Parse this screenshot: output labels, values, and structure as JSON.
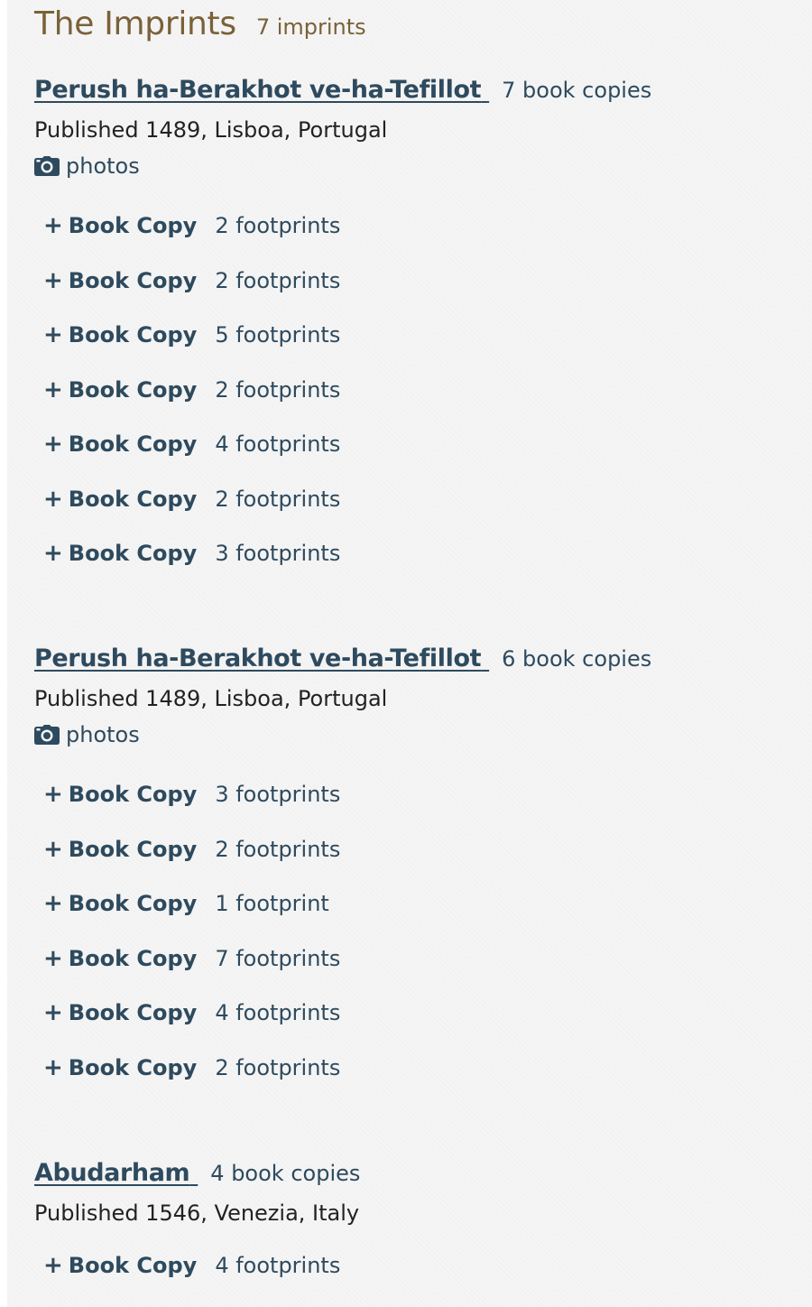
{
  "section": {
    "title": "The Imprints",
    "count": "7 imprints"
  },
  "imprints": [
    {
      "title": "Perush ha-Berakhot ve-ha-Tefillot",
      "copies_count": "7 book copies",
      "published": "Published 1489, Lisboa, Portugal",
      "photos_label": "photos",
      "copies": [
        {
          "label": "Book Copy",
          "footprints": "2 footprints"
        },
        {
          "label": "Book Copy",
          "footprints": "2 footprints"
        },
        {
          "label": "Book Copy",
          "footprints": "5 footprints"
        },
        {
          "label": "Book Copy",
          "footprints": "2 footprints"
        },
        {
          "label": "Book Copy",
          "footprints": "4 footprints"
        },
        {
          "label": "Book Copy",
          "footprints": "2 footprints"
        },
        {
          "label": "Book Copy",
          "footprints": "3 footprints"
        }
      ]
    },
    {
      "title": "Perush ha-Berakhot ve-ha-Tefillot",
      "copies_count": "6 book copies",
      "published": "Published 1489, Lisboa, Portugal",
      "photos_label": "photos",
      "copies": [
        {
          "label": "Book Copy",
          "footprints": "3 footprints"
        },
        {
          "label": "Book Copy",
          "footprints": "2 footprints"
        },
        {
          "label": "Book Copy",
          "footprints": "1 footprint"
        },
        {
          "label": "Book Copy",
          "footprints": "7 footprints"
        },
        {
          "label": "Book Copy",
          "footprints": "4 footprints"
        },
        {
          "label": "Book Copy",
          "footprints": "2 footprints"
        }
      ]
    },
    {
      "title": "Abudarham",
      "copies_count": "4 book copies",
      "published": "Published 1546, Venezia, Italy",
      "copies": [
        {
          "label": "Book Copy",
          "footprints": "4 footprints"
        }
      ]
    }
  ],
  "icons": {
    "photos": "camera-icon",
    "expand": "plus-icon"
  },
  "colors": {
    "heading": "#7a6138",
    "link": "#2e4a5e",
    "text": "#222222",
    "background": "#f5f5f5"
  }
}
